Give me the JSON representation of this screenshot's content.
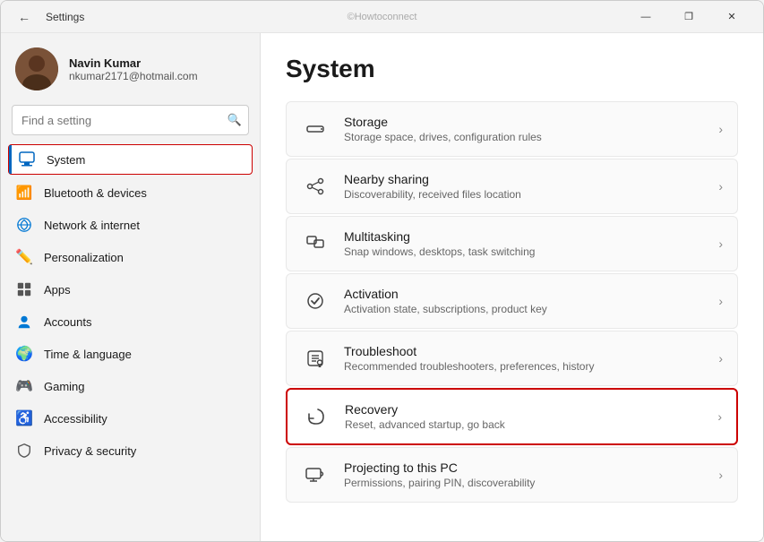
{
  "window": {
    "title": "Settings",
    "watermark": "©Howtoconnect",
    "controls": {
      "minimize": "—",
      "maximize": "❐",
      "close": "✕"
    }
  },
  "sidebar": {
    "user": {
      "name": "Navin Kumar",
      "email": "nkumar2171@hotmail.com"
    },
    "search": {
      "placeholder": "Find a setting"
    },
    "nav_items": [
      {
        "id": "system",
        "label": "System",
        "icon": "🖥️",
        "active": true
      },
      {
        "id": "bluetooth",
        "label": "Bluetooth & devices",
        "icon": "📶",
        "active": false
      },
      {
        "id": "network",
        "label": "Network & internet",
        "icon": "🌐",
        "active": false
      },
      {
        "id": "personalization",
        "label": "Personalization",
        "icon": "✏️",
        "active": false
      },
      {
        "id": "apps",
        "label": "Apps",
        "icon": "📦",
        "active": false
      },
      {
        "id": "accounts",
        "label": "Accounts",
        "icon": "👤",
        "active": false
      },
      {
        "id": "time",
        "label": "Time & language",
        "icon": "🌍",
        "active": false
      },
      {
        "id": "gaming",
        "label": "Gaming",
        "icon": "🎮",
        "active": false
      },
      {
        "id": "accessibility",
        "label": "Accessibility",
        "icon": "♿",
        "active": false
      },
      {
        "id": "privacy",
        "label": "Privacy & security",
        "icon": "🔒",
        "active": false
      }
    ]
  },
  "main": {
    "title": "System",
    "settings_items": [
      {
        "id": "storage",
        "name": "Storage",
        "desc": "Storage space, drives, configuration rules",
        "icon": "storage",
        "highlighted": false
      },
      {
        "id": "nearby-sharing",
        "name": "Nearby sharing",
        "desc": "Discoverability, received files location",
        "icon": "share",
        "highlighted": false
      },
      {
        "id": "multitasking",
        "name": "Multitasking",
        "desc": "Snap windows, desktops, task switching",
        "icon": "multitask",
        "highlighted": false
      },
      {
        "id": "activation",
        "name": "Activation",
        "desc": "Activation state, subscriptions, product key",
        "icon": "activation",
        "highlighted": false
      },
      {
        "id": "troubleshoot",
        "name": "Troubleshoot",
        "desc": "Recommended troubleshooters, preferences, history",
        "icon": "troubleshoot",
        "highlighted": false
      },
      {
        "id": "recovery",
        "name": "Recovery",
        "desc": "Reset, advanced startup, go back",
        "icon": "recovery",
        "highlighted": true
      },
      {
        "id": "projecting",
        "name": "Projecting to this PC",
        "desc": "Permissions, pairing PIN, discoverability",
        "icon": "project",
        "highlighted": false
      }
    ]
  }
}
